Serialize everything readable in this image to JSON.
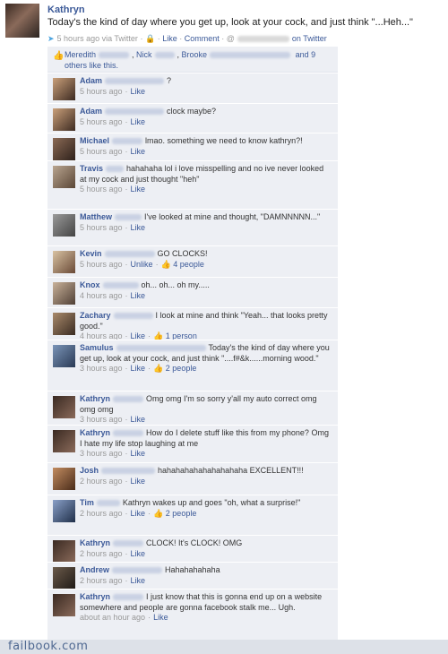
{
  "post": {
    "author": "Kathryn",
    "status": "Today's the kind of day where you get up, look at your cock, and just think \"...Heh...\"",
    "time": "5 hours ago via Twitter",
    "like": "Like",
    "comment": "Comment",
    "at_prefix": "@",
    "on_twitter": "on Twitter"
  },
  "likes": {
    "names": [
      "Meredith",
      "Nick",
      "Brooke"
    ],
    "tail": "and 9 others like this."
  },
  "comments": [
    {
      "name": "Adam",
      "text": "?",
      "time": "5 hours ago",
      "like": "Like",
      "count": ""
    },
    {
      "name": "Adam",
      "text": "clock maybe?",
      "time": "5 hours ago",
      "like": "Like",
      "count": ""
    },
    {
      "name": "Michael",
      "text": "lmao. something we need to know kathryn?!",
      "time": "5 hours ago",
      "like": "Like",
      "count": ""
    },
    {
      "name": "Travis",
      "text": "hahahaha lol i love misspelling and no ive never looked at my cock and just thought \"heh\"",
      "time": "5 hours ago",
      "like": "Like",
      "count": ""
    },
    {
      "name": "Matthew",
      "text": "I've looked at mine and thought, \"DAMNNNNN...\"",
      "time": "5 hours ago",
      "like": "Like",
      "count": ""
    },
    {
      "name": "Kevin",
      "text": "GO CLOCKS!",
      "time": "5 hours ago",
      "like": "Unlike",
      "count": "4 people"
    },
    {
      "name": "Knox",
      "text": "oh... oh... oh my.....",
      "time": "4 hours ago",
      "like": "Like",
      "count": ""
    },
    {
      "name": "Zachary",
      "text": "I look at mine and think \"Yeah... that looks pretty good.\"",
      "time": "4 hours ago",
      "like": "Like",
      "count": "1 person"
    },
    {
      "name": "Samulus",
      "text": "Today's the kind of day where you get up, look at your cock, and just think \"....f#&k......morning wood.\"",
      "time": "3 hours ago",
      "like": "Like",
      "count": "2 people"
    },
    {
      "name": "Kathryn",
      "text": "Omg omg I'm so sorry y'all my auto correct omg omg omg",
      "time": "3 hours ago",
      "like": "Like",
      "count": ""
    },
    {
      "name": "Kathryn",
      "text": "How do I delete stuff like this from my phone? Omg I hate my life stop laughing at me",
      "time": "3 hours ago",
      "like": "Like",
      "count": ""
    },
    {
      "name": "Josh",
      "text": "hahahahahahahahahaha EXCELLENT!!!",
      "time": "2 hours ago",
      "like": "Like",
      "count": ""
    },
    {
      "name": "Tim",
      "text": "Kathryn wakes up and goes \"oh, what a surprise!\"",
      "time": "2 hours ago",
      "like": "Like",
      "count": "2 people"
    },
    {
      "name": "Kathryn",
      "text": "CLOCK! It's CLOCK! OMG",
      "time": "2 hours ago",
      "like": "Like",
      "count": ""
    },
    {
      "name": "Andrew",
      "text": "Hahahahahaha",
      "time": "2 hours ago",
      "like": "Like",
      "count": ""
    },
    {
      "name": "Kathryn",
      "text": "I just know that this is gonna end up on a website somewhere and people are gonna facebook stalk me... Ugh.",
      "time": "about an hour ago",
      "like": "Like",
      "count": ""
    }
  ],
  "footer": {
    "logo": "failbook.com"
  }
}
